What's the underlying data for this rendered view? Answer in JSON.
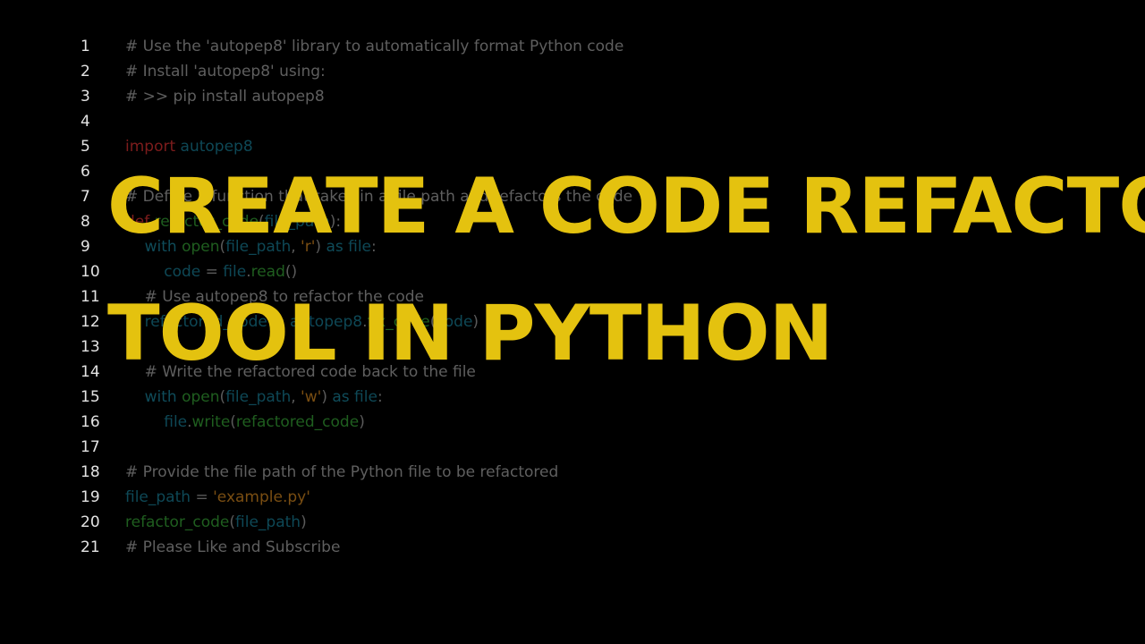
{
  "colors": {
    "background": "#000000",
    "title": "#e4c20f",
    "line_number": "#e3e3e3",
    "comment": "#5f5f5f",
    "keyword": "#7d1c1c",
    "keyword_secondary": "#0f4c5a",
    "function": "#1f5e1f",
    "variable": "#0e4856",
    "string": "#7a4e12"
  },
  "title": {
    "line1": "CREATE A CODE REFACTO",
    "line2": "TOOL IN PYTHON"
  },
  "code": {
    "lines": [
      {
        "n": "1",
        "tokens": [
          {
            "t": "# Use the 'autopep8' library to automatically format Python code",
            "c": "comment"
          }
        ]
      },
      {
        "n": "2",
        "tokens": [
          {
            "t": "# Install 'autopep8' using:",
            "c": "comment"
          }
        ]
      },
      {
        "n": "3",
        "tokens": [
          {
            "t": "# >> pip install autopep8",
            "c": "comment"
          }
        ]
      },
      {
        "n": "4",
        "tokens": []
      },
      {
        "n": "5",
        "tokens": [
          {
            "t": "import",
            "c": "keyword"
          },
          {
            "t": " autopep8",
            "c": "var"
          }
        ]
      },
      {
        "n": "6",
        "tokens": []
      },
      {
        "n": "7",
        "tokens": [
          {
            "t": "# Define a function that takes in a file path and refactors the code",
            "c": "comment"
          }
        ]
      },
      {
        "n": "8",
        "tokens": [
          {
            "t": "def",
            "c": "keyword"
          },
          {
            "t": " refactor_code",
            "c": "func"
          },
          {
            "t": "(",
            "c": "plain"
          },
          {
            "t": "file_path",
            "c": "var"
          },
          {
            "t": "):",
            "c": "plain"
          }
        ]
      },
      {
        "n": "9",
        "tokens": [
          {
            "t": "    ",
            "c": "plain"
          },
          {
            "t": "with",
            "c": "kw2"
          },
          {
            "t": " open",
            "c": "func"
          },
          {
            "t": "(",
            "c": "plain"
          },
          {
            "t": "file_path",
            "c": "var"
          },
          {
            "t": ", ",
            "c": "plain"
          },
          {
            "t": "'r'",
            "c": "str"
          },
          {
            "t": ") ",
            "c": "plain"
          },
          {
            "t": "as",
            "c": "kw2"
          },
          {
            "t": " file",
            "c": "var"
          },
          {
            "t": ":",
            "c": "plain"
          }
        ]
      },
      {
        "n": "10",
        "tokens": [
          {
            "t": "        ",
            "c": "plain"
          },
          {
            "t": "code",
            "c": "var"
          },
          {
            "t": " = ",
            "c": "plain"
          },
          {
            "t": "file",
            "c": "var"
          },
          {
            "t": ".",
            "c": "plain"
          },
          {
            "t": "read",
            "c": "func"
          },
          {
            "t": "()",
            "c": "plain"
          }
        ]
      },
      {
        "n": "11",
        "tokens": [
          {
            "t": "    ",
            "c": "plain"
          },
          {
            "t": "# Use autopep8 to refactor the code",
            "c": "comment"
          }
        ]
      },
      {
        "n": "12",
        "tokens": [
          {
            "t": "    ",
            "c": "plain"
          },
          {
            "t": "refactored_code",
            "c": "var"
          },
          {
            "t": " = ",
            "c": "plain"
          },
          {
            "t": "autopep8",
            "c": "var"
          },
          {
            "t": ".",
            "c": "plain"
          },
          {
            "t": "fix_code",
            "c": "func"
          },
          {
            "t": "(",
            "c": "plain"
          },
          {
            "t": "code",
            "c": "var"
          },
          {
            "t": ")",
            "c": "plain"
          }
        ]
      },
      {
        "n": "13",
        "tokens": []
      },
      {
        "n": "14",
        "tokens": [
          {
            "t": "    ",
            "c": "plain"
          },
          {
            "t": "# Write the refactored code back to the file",
            "c": "comment"
          }
        ]
      },
      {
        "n": "15",
        "tokens": [
          {
            "t": "    ",
            "c": "plain"
          },
          {
            "t": "with",
            "c": "kw2"
          },
          {
            "t": " open",
            "c": "func"
          },
          {
            "t": "(",
            "c": "plain"
          },
          {
            "t": "file_path",
            "c": "var"
          },
          {
            "t": ", ",
            "c": "plain"
          },
          {
            "t": "'w'",
            "c": "str"
          },
          {
            "t": ") ",
            "c": "plain"
          },
          {
            "t": "as",
            "c": "kw2"
          },
          {
            "t": " file",
            "c": "var"
          },
          {
            "t": ":",
            "c": "plain"
          }
        ]
      },
      {
        "n": "16",
        "tokens": [
          {
            "t": "        ",
            "c": "plain"
          },
          {
            "t": "file",
            "c": "var"
          },
          {
            "t": ".",
            "c": "plain"
          },
          {
            "t": "write",
            "c": "func"
          },
          {
            "t": "(",
            "c": "plain"
          },
          {
            "t": "refactored_code",
            "c": "func"
          },
          {
            "t": ")",
            "c": "plain"
          }
        ]
      },
      {
        "n": "17",
        "tokens": []
      },
      {
        "n": "18",
        "tokens": [
          {
            "t": "# Provide the file path of the Python file to be refactored",
            "c": "comment"
          }
        ]
      },
      {
        "n": "19",
        "tokens": [
          {
            "t": "file_path",
            "c": "var"
          },
          {
            "t": " = ",
            "c": "plain"
          },
          {
            "t": "'example.py'",
            "c": "str"
          }
        ]
      },
      {
        "n": "20",
        "tokens": [
          {
            "t": "refactor_code",
            "c": "func"
          },
          {
            "t": "(",
            "c": "plain"
          },
          {
            "t": "file_path",
            "c": "var"
          },
          {
            "t": ")",
            "c": "plain"
          }
        ]
      },
      {
        "n": "21",
        "tokens": [
          {
            "t": "# Please Like and Subscribe",
            "c": "comment"
          }
        ]
      }
    ]
  }
}
